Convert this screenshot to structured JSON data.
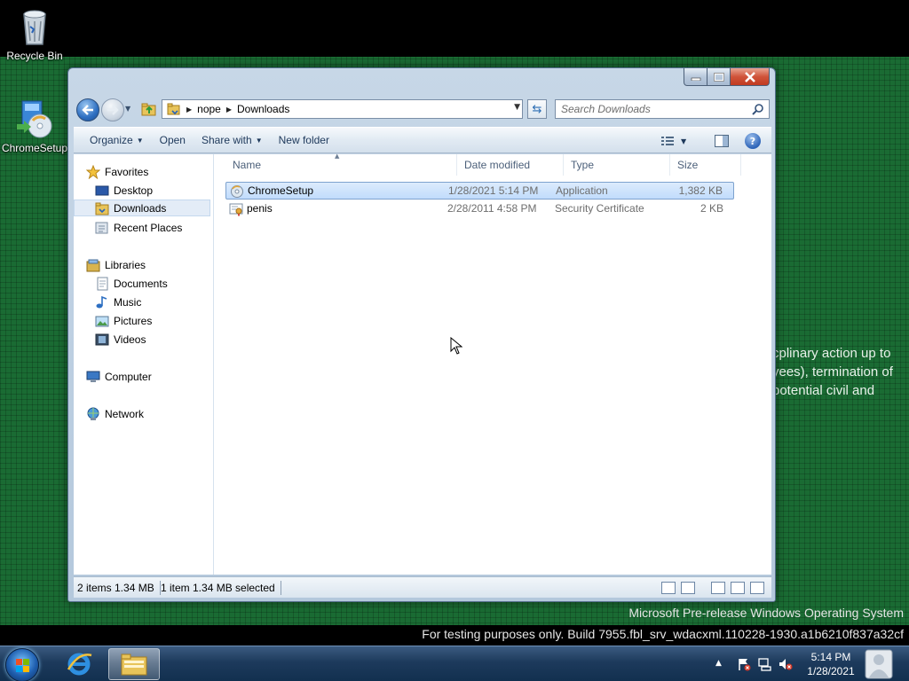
{
  "desktop": {
    "icons": [
      {
        "label": "Recycle Bin",
        "icon": "recycle-bin-icon"
      },
      {
        "label": "ChromeSetup",
        "icon": "installer-disc-icon"
      }
    ],
    "background_text": [
      "cplinary action up to",
      "yees), termination of",
      "potential civil and"
    ],
    "watermark_line1": "Microsoft Pre-release Windows Operating System",
    "watermark_line2": "For testing purposes only. Build 7955.fbl_srv_wdacxml.110228-1930.a1b6210f837a32cf"
  },
  "window": {
    "address": {
      "crumbs": [
        "nope",
        "Downloads"
      ]
    },
    "search": {
      "placeholder": "Search Downloads"
    },
    "commands": {
      "organize": "Organize",
      "open": "Open",
      "share_with": "Share with",
      "new_folder": "New folder"
    },
    "help_label": "?",
    "nav_pane": {
      "favorites_header": "Favorites",
      "favorites": [
        "Desktop",
        "Downloads",
        "Recent Places"
      ],
      "libraries_header": "Libraries",
      "libraries": [
        "Documents",
        "Music",
        "Pictures",
        "Videos"
      ],
      "computer": "Computer",
      "network": "Network",
      "selected": "Downloads"
    },
    "columns": {
      "name": "Name",
      "date": "Date modified",
      "type": "Type",
      "size": "Size"
    },
    "files": [
      {
        "name": "ChromeSetup",
        "date": "1/28/2021 5:14 PM",
        "type": "Application",
        "size": "1,382 KB",
        "selected": true,
        "icon": "application-icon"
      },
      {
        "name": "penis",
        "date": "2/28/2011 4:58 PM",
        "type": "Security Certificate",
        "size": "2 KB",
        "selected": false,
        "icon": "certificate-icon"
      }
    ],
    "status": {
      "items": "2 items 1.34 MB",
      "selection": "1 item 1.34 MB selected"
    }
  },
  "taskbar": {
    "clock_time": "5:14 PM",
    "clock_date": "1/28/2021",
    "tray_arrow": "▲"
  },
  "colors": {
    "accent": "#1e395b",
    "desktop": "#1a6b33",
    "selection": "#c1dcfc"
  }
}
